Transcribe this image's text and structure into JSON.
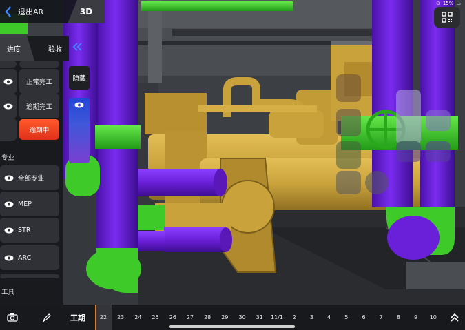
{
  "header": {
    "back_label": "退出AR",
    "mode_label": "3D"
  },
  "panel": {
    "tabs": [
      "进度",
      "验收"
    ],
    "hide_label": "隐藏",
    "status_rows": [
      {
        "label": "正常完工"
      },
      {
        "label": "逾期完工"
      },
      {
        "label": "逾期中"
      }
    ],
    "discipline_title": "专业",
    "disciplines": [
      {
        "label": "全部专业"
      },
      {
        "label": "MEP"
      },
      {
        "label": "STR"
      },
      {
        "label": "ARC"
      }
    ],
    "tools_title": "工具"
  },
  "bottom": {
    "period_label": "工期",
    "timeline": [
      "22",
      "23",
      "24",
      "25",
      "26",
      "27",
      "28",
      "29",
      "30",
      "31",
      "11/1",
      "2",
      "3",
      "4",
      "5",
      "6",
      "7",
      "8",
      "9",
      "10"
    ],
    "selected_index": 0
  },
  "status_bar": {
    "battery": "15%"
  },
  "icons": [
    "back-chevron-icon",
    "eye-icon",
    "double-chevron-left-icon",
    "camera-icon",
    "pen-icon",
    "qr-code-icon",
    "chevron-up-icon"
  ],
  "colors": {
    "pipe_purple": "#6a1fd8",
    "pipe_green": "#3ecb2a",
    "equipment_gold": "#c9a23c",
    "overdue_red": "#e8401f",
    "accent_orange": "#e07a2a"
  }
}
